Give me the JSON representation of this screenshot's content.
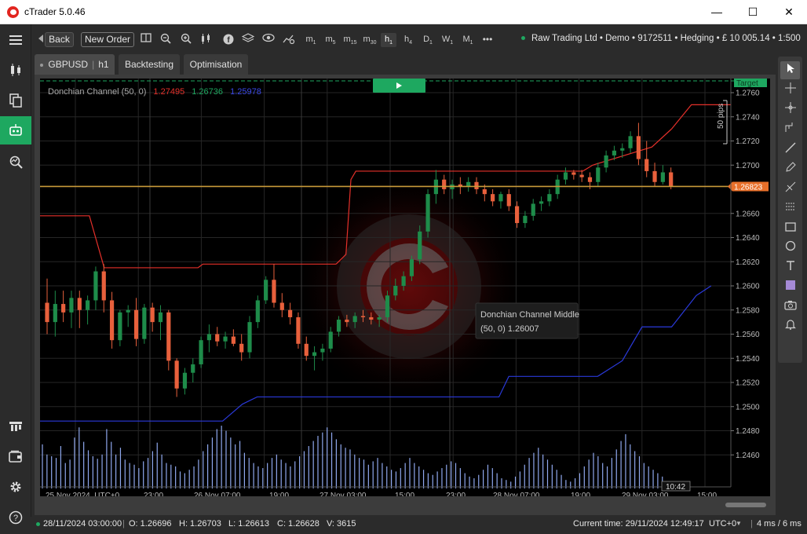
{
  "window": {
    "title": "cTrader 5.0.46",
    "minimize": "—",
    "maximize": "☐",
    "close": "✕"
  },
  "toolbar": {
    "back_label": "Back",
    "new_order_label": "New Order",
    "timeframes": [
      {
        "main": "m",
        "sub": "1"
      },
      {
        "main": "m",
        "sub": "5"
      },
      {
        "main": "m",
        "sub": "15"
      },
      {
        "main": "m",
        "sub": "30"
      },
      {
        "main": "h",
        "sub": "1"
      },
      {
        "main": "h",
        "sub": "4"
      },
      {
        "main": "D",
        "sub": "1"
      },
      {
        "main": "W",
        "sub": "1"
      },
      {
        "main": "M",
        "sub": "1"
      }
    ],
    "selected_timeframe": "h1",
    "more": "•••",
    "account": "Raw Trading Ltd • Demo • 9172511 • Hedging • £ 10 005.14 • 1:500"
  },
  "tabs": {
    "symbol": "GBPUSD",
    "timeframe": "h1",
    "backtesting": "Backtesting",
    "optimisation": "Optimisation"
  },
  "chart": {
    "indicator_name": "Donchian Channel (50, 0)",
    "indicator_upper": "1.27495",
    "indicator_middle": "1.26736",
    "indicator_lower": "1.25978",
    "target_label": "Target",
    "pips_label": "50 pips",
    "current_price": "1.26823",
    "tooltip_title": "Donchian Channel Middle",
    "tooltip_value": "(50, 0)  1.26007",
    "time_badge": "10:42",
    "colors": {
      "up_candle": "#1e8c4a",
      "down_candle": "#e8603c",
      "upper_band": "#e5302a",
      "lower_band": "#2a39d9",
      "price_line": "#c99a3a",
      "volume": "#8fa8ee",
      "play_button": "#1ea860"
    }
  },
  "chart_data": {
    "type": "candlestick",
    "symbol": "GBPUSD",
    "timeframe": "h1",
    "y_axis_labels": [
      "1.2760",
      "1.2740",
      "1.2720",
      "1.2700",
      "1.2660",
      "1.2640",
      "1.2620",
      "1.2600",
      "1.2580",
      "1.2560",
      "1.2540",
      "1.2520",
      "1.2500",
      "1.2480",
      "1.2460"
    ],
    "ylim": [
      1.2448,
      1.2767
    ],
    "x_axis_labels": [
      "25 Nov 2024, UTC+0",
      "23:00",
      "26 Nov 07:00",
      "19:00",
      "27 Nov 03:00",
      "15:00",
      "23:00",
      "28 Nov 07:00",
      "19:00",
      "29 Nov 03:00",
      "15:00"
    ],
    "candles_ohlc": [
      [
        1.2586,
        1.2606,
        1.256,
        1.257
      ],
      [
        1.257,
        1.2596,
        1.2558,
        1.2585
      ],
      [
        1.2585,
        1.2596,
        1.257,
        1.2578
      ],
      [
        1.2578,
        1.2596,
        1.2565,
        1.259
      ],
      [
        1.259,
        1.2596,
        1.2565,
        1.258
      ],
      [
        1.258,
        1.2592,
        1.2568,
        1.2588
      ],
      [
        1.2588,
        1.2616,
        1.258,
        1.2612
      ],
      [
        1.2612,
        1.2618,
        1.2578,
        1.2588
      ],
      [
        1.2588,
        1.2595,
        1.2548,
        1.2555
      ],
      [
        1.2555,
        1.258,
        1.255,
        1.2578
      ],
      [
        1.2578,
        1.2584,
        1.2566,
        1.258
      ],
      [
        1.258,
        1.259,
        1.255,
        1.2556
      ],
      [
        1.2556,
        1.2585,
        1.2552,
        1.2582
      ],
      [
        1.2582,
        1.2586,
        1.2562,
        1.257
      ],
      [
        1.257,
        1.2584,
        1.2555,
        1.2578
      ],
      [
        1.2578,
        1.258,
        1.253,
        1.2538
      ],
      [
        1.2538,
        1.254,
        1.2508,
        1.2515
      ],
      [
        1.2515,
        1.2532,
        1.251,
        1.2528
      ],
      [
        1.2528,
        1.254,
        1.252,
        1.2535
      ],
      [
        1.2535,
        1.2558,
        1.2532,
        1.2555
      ],
      [
        1.2555,
        1.2568,
        1.2545,
        1.256
      ],
      [
        1.256,
        1.2566,
        1.255,
        1.2554
      ],
      [
        1.2554,
        1.2562,
        1.2548,
        1.2558
      ],
      [
        1.2558,
        1.2564,
        1.255,
        1.2552
      ],
      [
        1.2552,
        1.256,
        1.2538,
        1.2545
      ],
      [
        1.2545,
        1.2575,
        1.254,
        1.257
      ],
      [
        1.257,
        1.2592,
        1.2565,
        1.2588
      ],
      [
        1.2588,
        1.2608,
        1.2585,
        1.2605
      ],
      [
        1.2605,
        1.2618,
        1.2582,
        1.2586
      ],
      [
        1.2586,
        1.2594,
        1.2574,
        1.258
      ],
      [
        1.258,
        1.2586,
        1.2568,
        1.2574
      ],
      [
        1.2574,
        1.2578,
        1.2548,
        1.2552
      ],
      [
        1.2552,
        1.2558,
        1.2538,
        1.2542
      ],
      [
        1.2542,
        1.255,
        1.253,
        1.2545
      ],
      [
        1.2545,
        1.2552,
        1.2538,
        1.2548
      ],
      [
        1.2548,
        1.2566,
        1.2545,
        1.2562
      ],
      [
        1.2562,
        1.2575,
        1.2558,
        1.2572
      ],
      [
        1.2572,
        1.2576,
        1.2566,
        1.257
      ],
      [
        1.257,
        1.2578,
        1.2565,
        1.2575
      ],
      [
        1.2575,
        1.258,
        1.257,
        1.2574
      ],
      [
        1.2574,
        1.2578,
        1.2568,
        1.2572
      ],
      [
        1.2572,
        1.2576,
        1.2566,
        1.2574
      ],
      [
        1.2574,
        1.2596,
        1.257,
        1.2592
      ],
      [
        1.2592,
        1.2606,
        1.2588,
        1.26
      ],
      [
        1.26,
        1.2612,
        1.2596,
        1.2608
      ],
      [
        1.2608,
        1.2625,
        1.2604,
        1.2622
      ],
      [
        1.2622,
        1.265,
        1.2618,
        1.2645
      ],
      [
        1.2645,
        1.268,
        1.264,
        1.2676
      ],
      [
        1.2676,
        1.2696,
        1.2668,
        1.2688
      ],
      [
        1.2688,
        1.2692,
        1.2676,
        1.268
      ],
      [
        1.268,
        1.2688,
        1.2672,
        1.2684
      ],
      [
        1.2684,
        1.269,
        1.2676,
        1.2682
      ],
      [
        1.2682,
        1.269,
        1.2678,
        1.2686
      ],
      [
        1.2686,
        1.269,
        1.2676,
        1.268
      ],
      [
        1.268,
        1.2684,
        1.267,
        1.2676
      ],
      [
        1.2676,
        1.268,
        1.2666,
        1.267
      ],
      [
        1.267,
        1.2678,
        1.2664,
        1.2676
      ],
      [
        1.2676,
        1.268,
        1.2662,
        1.2666
      ],
      [
        1.2666,
        1.267,
        1.2648,
        1.2652
      ],
      [
        1.2652,
        1.2662,
        1.2648,
        1.2658
      ],
      [
        1.2658,
        1.2672,
        1.2654,
        1.2668
      ],
      [
        1.2668,
        1.2674,
        1.2662,
        1.267
      ],
      [
        1.267,
        1.268,
        1.2666,
        1.2676
      ],
      [
        1.2676,
        1.2692,
        1.2672,
        1.2688
      ],
      [
        1.2688,
        1.2698,
        1.2684,
        1.2694
      ],
      [
        1.2694,
        1.2696,
        1.2688,
        1.2692
      ],
      [
        1.2692,
        1.2696,
        1.2686,
        1.269
      ],
      [
        1.269,
        1.2694,
        1.268,
        1.2686
      ],
      [
        1.2686,
        1.2702,
        1.2682,
        1.2698
      ],
      [
        1.2698,
        1.2712,
        1.2694,
        1.2708
      ],
      [
        1.2708,
        1.2716,
        1.2704,
        1.2712
      ],
      [
        1.2712,
        1.2718,
        1.2706,
        1.2714
      ],
      [
        1.2714,
        1.2728,
        1.271,
        1.2724
      ],
      [
        1.2724,
        1.2735,
        1.27,
        1.2705
      ],
      [
        1.2705,
        1.272,
        1.269,
        1.2695
      ],
      [
        1.2695,
        1.2702,
        1.2682,
        1.2686
      ],
      [
        1.2686,
        1.27,
        1.2684,
        1.2694
      ],
      [
        1.2694,
        1.2698,
        1.268,
        1.2682
      ]
    ],
    "upper_band_segments": [
      [
        [
          0,
          1.2658
        ],
        [
          10,
          1.2658
        ],
        [
          13,
          1.2615
        ],
        [
          32,
          1.2615
        ],
        [
          33,
          1.2618
        ],
        [
          60,
          1.2618
        ]
      ],
      [
        [
          60,
          1.2618
        ],
        [
          62,
          1.2626
        ],
        [
          63,
          1.2688
        ],
        [
          64,
          1.2695
        ],
        [
          100,
          1.2695
        ],
        [
          110,
          1.2695
        ],
        [
          112,
          1.27
        ],
        [
          124,
          1.2715
        ],
        [
          128,
          1.273
        ]
      ],
      [
        [
          128,
          1.273
        ],
        [
          132,
          1.275
        ],
        [
          140,
          1.275
        ]
      ]
    ],
    "lower_band": [
      [
        0,
        1.2488
      ],
      [
        37,
        1.2488
      ],
      [
        41,
        1.2502
      ],
      [
        44,
        1.2508
      ],
      [
        93,
        1.2508
      ],
      [
        95,
        1.2525
      ],
      [
        113,
        1.2525
      ],
      [
        118,
        1.2538
      ],
      [
        122,
        1.2566
      ],
      [
        128,
        1.2566
      ],
      [
        133,
        1.2592
      ],
      [
        136,
        1.26
      ]
    ],
    "current_price_value": 1.26823,
    "volumes": [
      0.52,
      0.4,
      0.38,
      0.36,
      0.5,
      0.3,
      0.34,
      0.6,
      0.72,
      0.55,
      0.45,
      0.38,
      0.35,
      0.4,
      0.7,
      0.55,
      0.4,
      0.48,
      0.34,
      0.3,
      0.28,
      0.24,
      0.32,
      0.36,
      0.44,
      0.54,
      0.4,
      0.3,
      0.28,
      0.26,
      0.2,
      0.18,
      0.22,
      0.26,
      0.34,
      0.44,
      0.52,
      0.6,
      0.7,
      0.74,
      0.68,
      0.6,
      0.52,
      0.56,
      0.42,
      0.36,
      0.3,
      0.26,
      0.24,
      0.3,
      0.36,
      0.4,
      0.34,
      0.3,
      0.26,
      0.32,
      0.38,
      0.44,
      0.5,
      0.56,
      0.62,
      0.66,
      0.72,
      0.66,
      0.58,
      0.52,
      0.48,
      0.46,
      0.4,
      0.36,
      0.34,
      0.28,
      0.32,
      0.36,
      0.3,
      0.26,
      0.22,
      0.2,
      0.24,
      0.3,
      0.36,
      0.3,
      0.26,
      0.22,
      0.18,
      0.16,
      0.2,
      0.24,
      0.28,
      0.32,
      0.3,
      0.24,
      0.18,
      0.14,
      0.12,
      0.16,
      0.22,
      0.28,
      0.24,
      0.18,
      0.12,
      0.1,
      0.08,
      0.14,
      0.2,
      0.28,
      0.36,
      0.42,
      0.48,
      0.4,
      0.34,
      0.28,
      0.22,
      0.16,
      0.1,
      0.08,
      0.12,
      0.18,
      0.26,
      0.34,
      0.42,
      0.38,
      0.3,
      0.26,
      0.36,
      0.46,
      0.56,
      0.64,
      0.52,
      0.44,
      0.38,
      0.3,
      0.26,
      0.22,
      0.18,
      0.14
    ]
  },
  "status": {
    "bar_time": "28/11/2024 03:00:00",
    "open": "O: 1.26696",
    "high": "H: 1.26703",
    "low": "L: 1.26613",
    "close": "C: 1.26628",
    "volume": "V: 3615",
    "current_time": "Current time:  29/11/2024 12:49:17",
    "utc": "UTC+0",
    "latency": "4 ms / 6 ms"
  }
}
